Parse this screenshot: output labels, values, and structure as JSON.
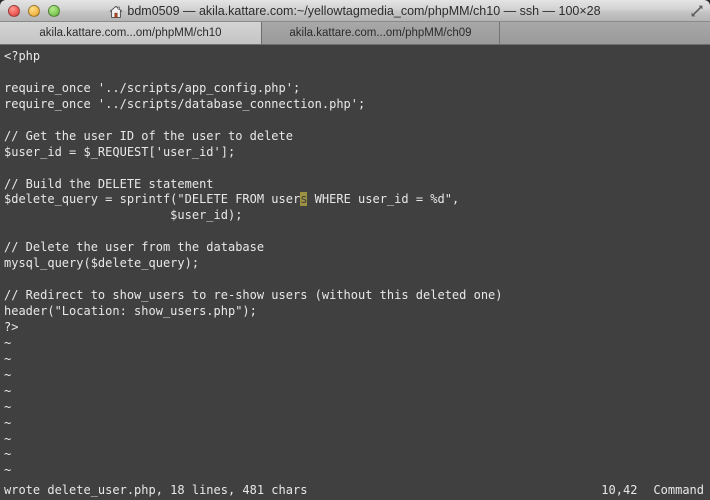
{
  "window": {
    "title": "bdm0509 — akila.kattare.com:~/yellowtagmedia_com/phpMM/ch10 — ssh — 100×28",
    "home_icon": "house-icon",
    "fullscreen_icon": "fullscreen-arrows-icon",
    "buttons": {
      "close": "close-button",
      "minimize": "minimize-button",
      "zoom": "zoom-button"
    }
  },
  "tabs": [
    {
      "label": "akila.kattare.com...om/phpMM/ch10",
      "active": true
    },
    {
      "label": "akila.kattare.com...om/phpMM/ch09",
      "active": false
    }
  ],
  "editor": {
    "lines": [
      {
        "pre": "<?php"
      },
      {
        "pre": ""
      },
      {
        "pre": "require_once '../scripts/app_config.php';"
      },
      {
        "pre": "require_once '../scripts/database_connection.php';"
      },
      {
        "pre": ""
      },
      {
        "pre": "// Get the user ID of the user to delete"
      },
      {
        "pre": "$user_id = $_REQUEST['user_id'];"
      },
      {
        "pre": ""
      },
      {
        "pre": "// Build the DELETE statement"
      },
      {
        "pre": "$delete_query = sprintf(\"DELETE FROM user",
        "cursor": "s",
        "post": " WHERE user_id = %d\","
      },
      {
        "pre": "                       $user_id);"
      },
      {
        "pre": ""
      },
      {
        "pre": "// Delete the user from the database"
      },
      {
        "pre": "mysql_query($delete_query);"
      },
      {
        "pre": ""
      },
      {
        "pre": "// Redirect to show_users to re-show users (without this deleted one)"
      },
      {
        "pre": "header(\"Location: show_users.php\");"
      },
      {
        "pre": "?>"
      },
      {
        "pre": "~"
      },
      {
        "pre": "~"
      },
      {
        "pre": "~"
      },
      {
        "pre": "~"
      },
      {
        "pre": "~"
      },
      {
        "pre": "~"
      },
      {
        "pre": "~"
      },
      {
        "pre": "~"
      },
      {
        "pre": "~"
      }
    ]
  },
  "status": {
    "message": "wrote delete_user.php, 18 lines, 481 chars",
    "position": "10,42",
    "mode": "Command"
  },
  "colors": {
    "terminal_bg": "#404040",
    "terminal_fg": "#e8e8e8",
    "cursor_bg": "#9d9142",
    "titlebar_bg": "#d2d2d2",
    "tabbar_bg": "#a0a0a0",
    "active_tab_bg": "#c8c8c8"
  }
}
